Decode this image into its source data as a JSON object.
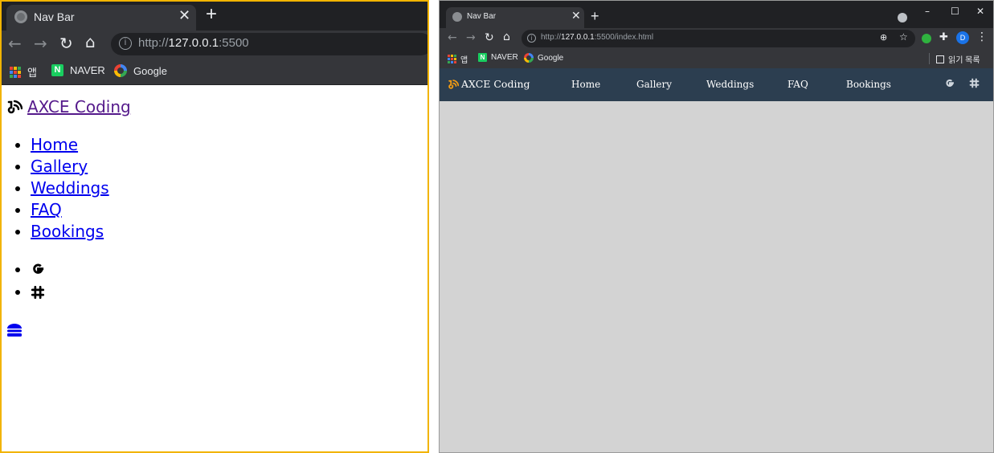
{
  "left_browser": {
    "tab_title": "Nav Bar",
    "url_prefix": "http://",
    "url_host": "127.0.0.1",
    "url_port": ":5500",
    "bookmarks": [
      "앱",
      "NAVER",
      "Google"
    ],
    "page": {
      "logo_text": "AXCE Coding",
      "nav_links": [
        "Home",
        "Gallery",
        "Weddings",
        "FAQ",
        "Bookings"
      ]
    }
  },
  "right_browser": {
    "tab_title": "Nav Bar",
    "url_prefix": "http://",
    "url_host": "127.0.0.1",
    "url_rest": ":5500/index.html",
    "avatar_letter": "D",
    "bookmarks": [
      "앱",
      "NAVER",
      "Google"
    ],
    "reading_list": "읽기 목록",
    "page": {
      "logo_text": "AXCE Coding",
      "nav_links": [
        "Home",
        "Gallery",
        "Weddings",
        "FAQ",
        "Bookings"
      ],
      "nav_bg": "#2c3e50",
      "accent": "#f39c12",
      "body_bg": "#d3d3d3"
    }
  },
  "icons": {
    "logo": "blogger-icon",
    "social": [
      "google-icon",
      "slack-icon"
    ],
    "menu": "hamburger-icon"
  }
}
